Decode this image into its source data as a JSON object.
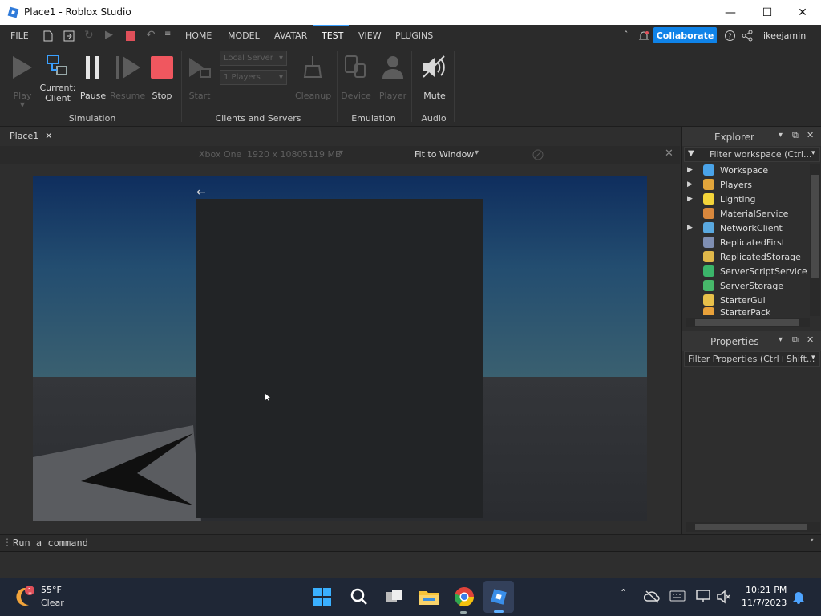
{
  "window": {
    "title": "Place1 - Roblox Studio"
  },
  "menubar": {
    "file": "FILE",
    "tabs": [
      "HOME",
      "MODEL",
      "AVATAR",
      "TEST",
      "VIEW",
      "PLUGINS"
    ],
    "active_tab": "TEST",
    "collaborate": "Collaborate",
    "username": "likeejamin"
  },
  "ribbon": {
    "simulation": {
      "play": "Play",
      "current_client_1": "Current:",
      "current_client_2": "Client",
      "pause": "Pause",
      "resume": "Resume",
      "stop": "Stop",
      "label": "Simulation"
    },
    "clients": {
      "start": "Start",
      "server_dropdown": "Local Server",
      "players_dropdown": "1 Players",
      "cleanup": "Cleanup",
      "label": "Clients and Servers"
    },
    "emulation": {
      "device": "Device",
      "player": "Player",
      "label": "Emulation"
    },
    "audio": {
      "mute": "Mute",
      "label": "Audio"
    }
  },
  "doc_tab": {
    "label": "Place1"
  },
  "viewbar": {
    "device": "Xbox One",
    "resolution": "1920 x 1080",
    "memory": "5119 MB",
    "fit": "Fit to Window"
  },
  "explorer": {
    "title": "Explorer",
    "filter_placeholder": "Filter workspace (Ctrl...",
    "items": [
      {
        "label": "Workspace",
        "expandable": true,
        "color": "#4aa3e8"
      },
      {
        "label": "Players",
        "expandable": true,
        "color": "#e2a53b"
      },
      {
        "label": "Lighting",
        "expandable": true,
        "color": "#f3d43a"
      },
      {
        "label": "MaterialService",
        "expandable": false,
        "color": "#d9883d"
      },
      {
        "label": "NetworkClient",
        "expandable": true,
        "color": "#5aa9e0"
      },
      {
        "label": "ReplicatedFirst",
        "expandable": false,
        "color": "#7f8fb3"
      },
      {
        "label": "ReplicatedStorage",
        "expandable": false,
        "color": "#e0b84a"
      },
      {
        "label": "ServerScriptService",
        "expandable": false,
        "color": "#3bb56a"
      },
      {
        "label": "ServerStorage",
        "expandable": false,
        "color": "#47b86a"
      },
      {
        "label": "StarterGui",
        "expandable": false,
        "color": "#e8c04a"
      },
      {
        "label": "StarterPack",
        "expandable": false,
        "color": "#e8a13a"
      }
    ]
  },
  "properties": {
    "title": "Properties",
    "filter_placeholder": "Filter Properties (Ctrl+Shift..."
  },
  "command_bar": {
    "placeholder": "Run a command"
  },
  "taskbar": {
    "weather_temp": "55°F",
    "weather_desc": "Clear",
    "weather_badge": "1",
    "time": "10:21 PM",
    "date": "11/7/2023"
  }
}
